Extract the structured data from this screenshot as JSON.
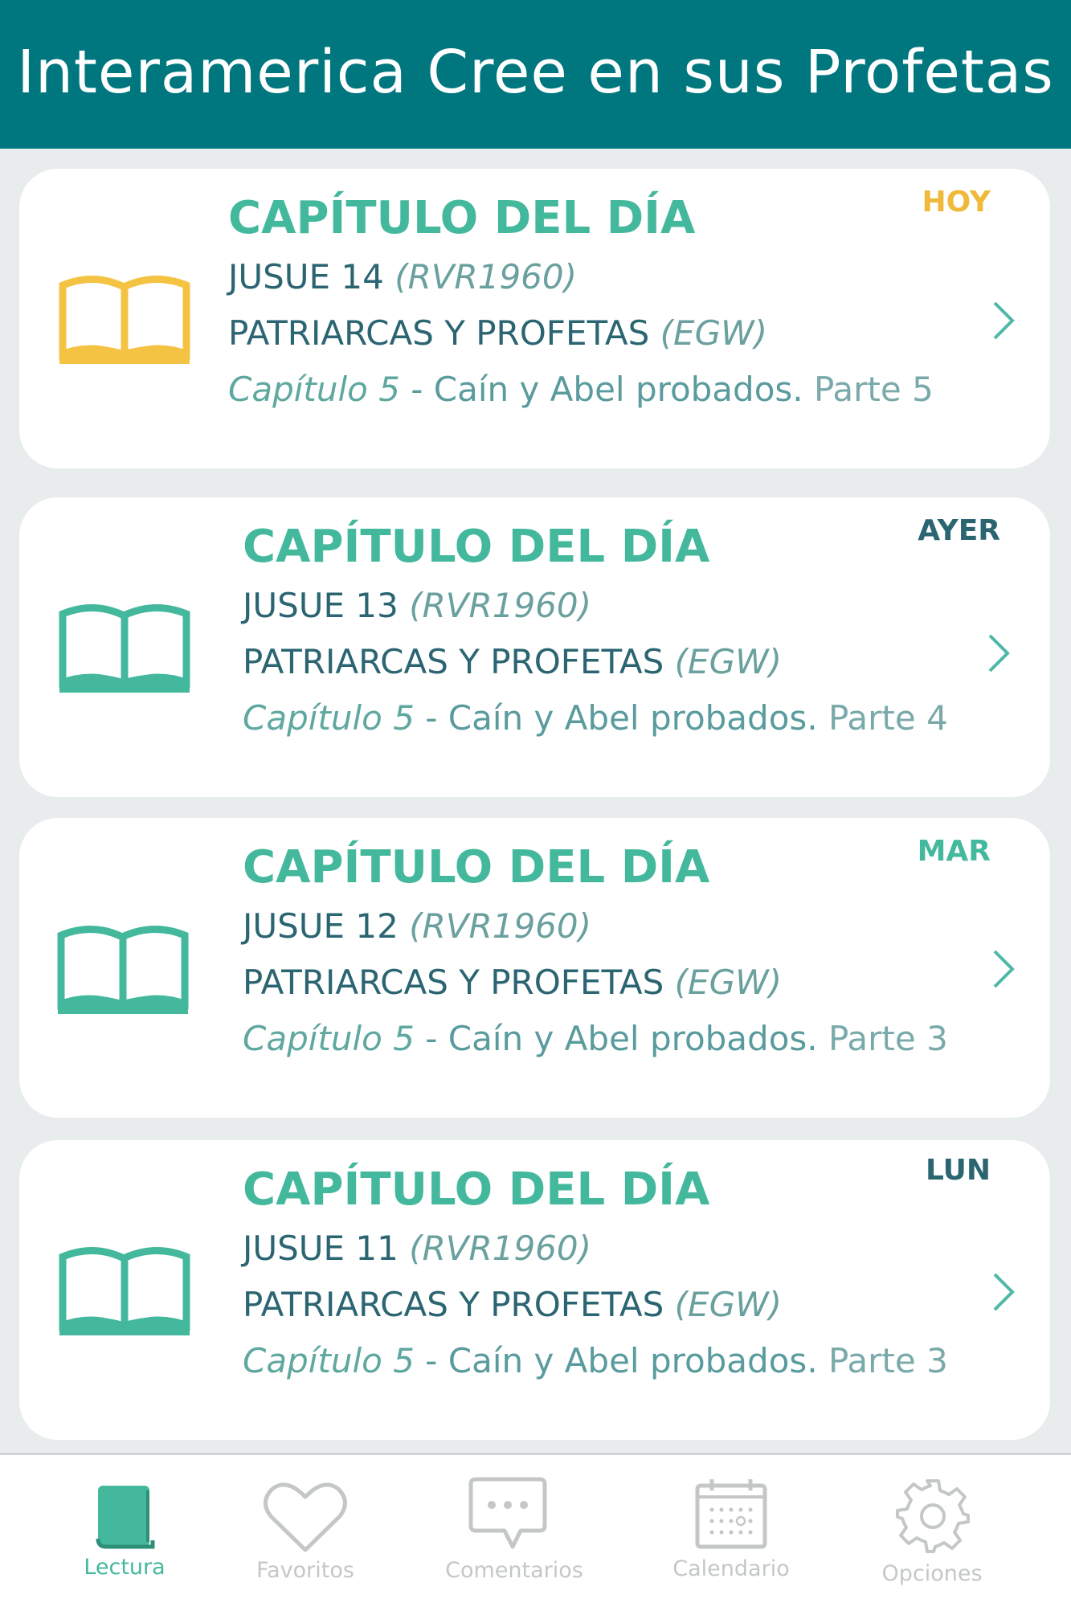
{
  "header": {
    "title": "Interamerica Cree en sus Profetas"
  },
  "colors": {
    "header_bg": "#00777f",
    "accent_green": "#44b89d",
    "accent_yellow": "#f5c343",
    "inactive_gray": "#c4c7c8"
  },
  "readings": [
    {
      "day": "HOY",
      "title": "CAPÍTULO DEL DÍA",
      "bible_book": "JUSUE 14",
      "bible_version": "(RVR1960)",
      "book": "PATRIARCAS Y PROFETAS",
      "book_author": "(EGW)",
      "chapter": "Capítulo 5",
      "chapter_title": " - Caín y Abel probados.",
      "part": " Parte 5",
      "icon": "open-book-icon"
    },
    {
      "day": "AYER",
      "title": "CAPÍTULO DEL DÍA",
      "bible_book": "JUSUE 13",
      "bible_version": "(RVR1960)",
      "book": "PATRIARCAS Y PROFETAS",
      "book_author": "(EGW)",
      "chapter": "Capítulo 5",
      "chapter_title": " - Caín y Abel probados.",
      "part": " Parte 4",
      "icon": "open-book-icon"
    },
    {
      "day": "MAR",
      "title": "CAPÍTULO DEL DÍA",
      "bible_book": "JUSUE 12",
      "bible_version": "(RVR1960)",
      "book": "PATRIARCAS Y PROFETAS",
      "book_author": "(EGW)",
      "chapter": "Capítulo 5",
      "chapter_title": " - Caín y Abel probados.",
      "part": " Parte 3",
      "icon": "open-book-icon"
    },
    {
      "day": "LUN",
      "title": "CAPÍTULO DEL DÍA",
      "bible_book": "JUSUE 11",
      "bible_version": "(RVR1960)",
      "book": "PATRIARCAS Y PROFETAS",
      "book_author": "(EGW)",
      "chapter": "Capítulo 5",
      "chapter_title": " - Caín y Abel probados.",
      "part": " Parte 3",
      "icon": "open-book-icon"
    }
  ],
  "tabs": [
    {
      "label": "Lectura",
      "icon": "book-icon",
      "active": true
    },
    {
      "label": "Favoritos",
      "icon": "heart-icon",
      "active": false
    },
    {
      "label": "Comentarios",
      "icon": "chat-bubble-icon",
      "active": false
    },
    {
      "label": "Calendario",
      "icon": "calendar-icon",
      "active": false
    },
    {
      "label": "Opciones",
      "icon": "gear-icon",
      "active": false
    }
  ]
}
